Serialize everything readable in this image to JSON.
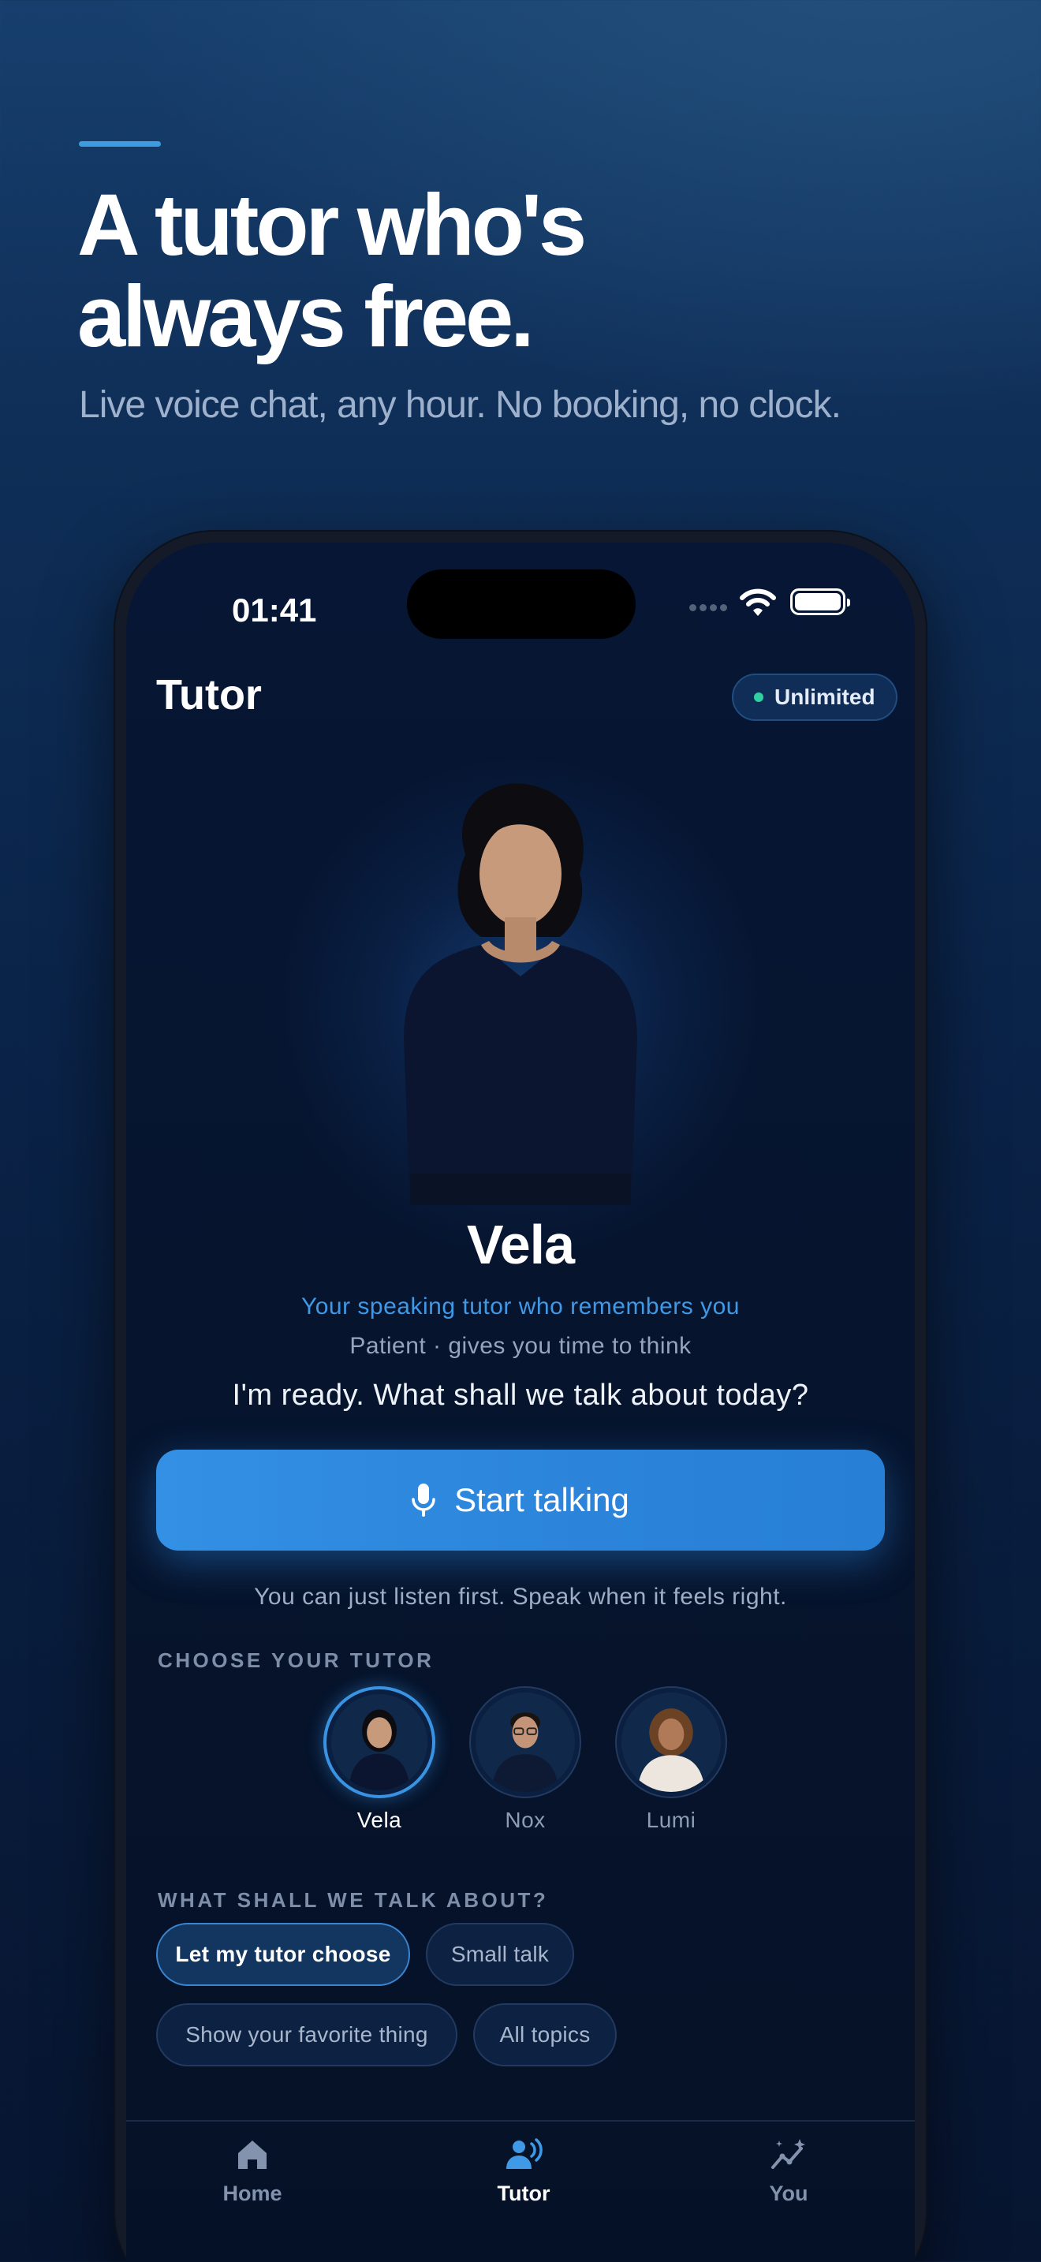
{
  "promo": {
    "headline_line1": "A tutor who's",
    "headline_line2": "always free.",
    "subheadline": "Live voice chat, any hour. No booking, no clock."
  },
  "status_bar": {
    "time": "01:41"
  },
  "app": {
    "title": "Tutor",
    "badge": "Unlimited"
  },
  "tutor": {
    "name": "Vela",
    "tagline": "Your speaking tutor who remembers you",
    "trait": "Patient · gives you time to think",
    "greeting": "I'm ready. What shall we talk about today?"
  },
  "cta": {
    "label": "Start talking",
    "hint": "You can just listen first. Speak when it feels right."
  },
  "choose_tutor": {
    "label": "CHOOSE YOUR TUTOR",
    "options": [
      {
        "name": "Vela",
        "selected": true
      },
      {
        "name": "Nox",
        "selected": false
      },
      {
        "name": "Lumi",
        "selected": false
      }
    ]
  },
  "topics": {
    "label": "WHAT SHALL WE TALK ABOUT?",
    "chips": [
      {
        "label": "Let my tutor choose",
        "selected": true
      },
      {
        "label": "Small talk",
        "selected": false
      },
      {
        "label": "Show your favorite thing",
        "selected": false
      },
      {
        "label": "All topics",
        "selected": false
      }
    ]
  },
  "tab_bar": {
    "tabs": [
      {
        "label": "Home",
        "icon": "home-icon",
        "active": false
      },
      {
        "label": "Tutor",
        "icon": "voice-tutor-icon",
        "active": true
      },
      {
        "label": "You",
        "icon": "progress-sparkle-icon",
        "active": false
      }
    ]
  },
  "colors": {
    "accent": "#3390e4",
    "badge_dot": "#2fd1a0",
    "tagline": "#3f99e6"
  }
}
